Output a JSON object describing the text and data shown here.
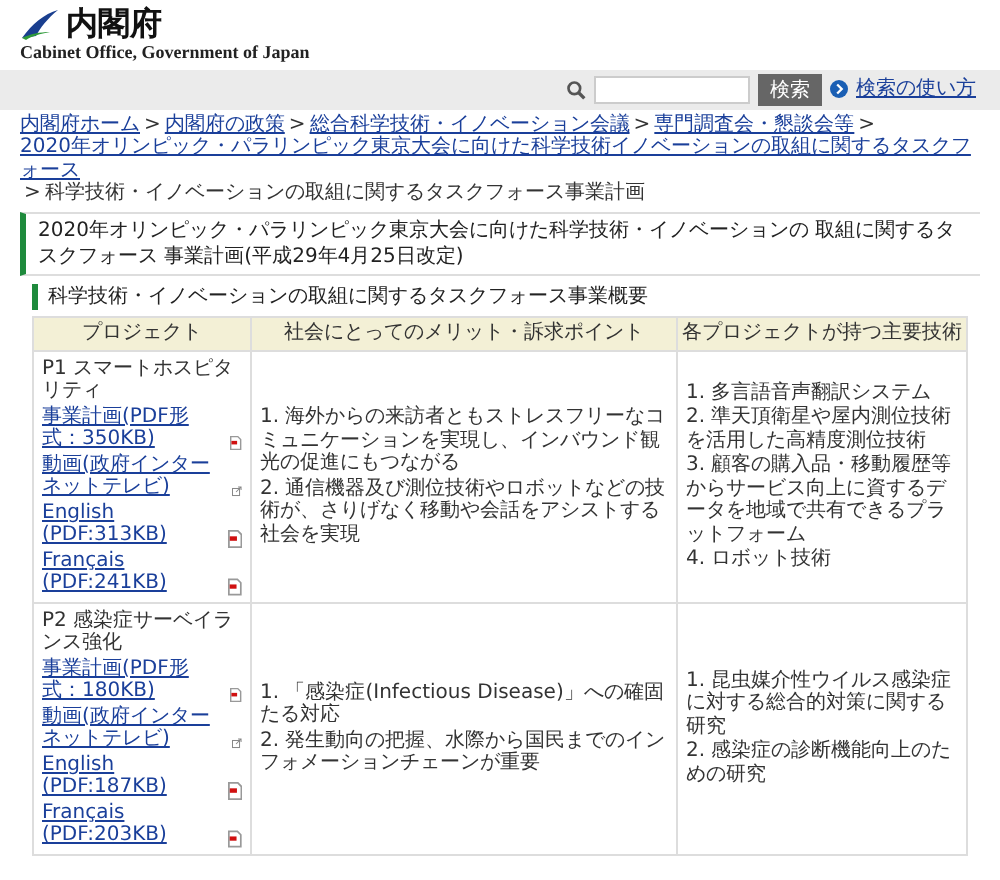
{
  "header": {
    "logo_text": "内閣府",
    "logo_subtitle": "Cabinet Office, Government of Japan"
  },
  "search": {
    "button": "検索",
    "help_link": "検索の使い方"
  },
  "breadcrumb": {
    "links": [
      "内閣府ホーム",
      "内閣府の政策",
      "総合科学技術・イノベーション会議",
      "専門調査会・懇談会等",
      "2020年オリンピック・パラリンピック東京大会に向けた科学技術イノベーションの取組に関するタスクフォース"
    ],
    "separator": ">",
    "current": "科学技術・イノベーションの取組に関するタスクフォース事業計画"
  },
  "page_title": "2020年オリンピック・パラリンピック東京大会に向けた科学技術・イノベーションの 取組に関するタスクフォース 事業計画(平成29年4月25日改定)",
  "section_title": "科学技術・イノベーションの取組に関するタスクフォース事業概要",
  "table": {
    "columns": [
      "プロジェクト",
      "社会にとってのメリット・訴求ポイント",
      "各プロジェクトが持つ主要技術"
    ],
    "rows": [
      {
        "project": "P1 スマートホスピタリティ",
        "links": [
          {
            "kind": "pdf",
            "text": "事業計画(PDF形式：350KB)"
          },
          {
            "kind": "external",
            "text": "動画(政府インターネットテレビ)"
          },
          {
            "kind": "pdf",
            "text": "English (PDF:313KB)"
          },
          {
            "kind": "pdf",
            "text": "Français (PDF:241KB)"
          }
        ],
        "merits": [
          "1. 海外からの来訪者ともストレスフリーなコミュニケーションを実現し、インバウンド観光の促進にもつながる",
          "2. 通信機器及び測位技術やロボットなどの技術が、さりげなく移動や会話をアシストする社会を実現"
        ],
        "technologies": [
          "1. 多言語音声翻訳システム",
          "2. 準天頂衛星や屋内測位技術を活用した高精度測位技術",
          "3. 顧客の購入品・移動履歴等からサービス向上に資するデータを地域で共有できるプラットフォーム",
          "4. ロボット技術"
        ]
      },
      {
        "project": "P2 感染症サーベイランス強化",
        "links": [
          {
            "kind": "pdf",
            "text": "事業計画(PDF形式：180KB)"
          },
          {
            "kind": "external",
            "text": "動画(政府インターネットテレビ)"
          },
          {
            "kind": "pdf",
            "text": "English (PDF:187KB)"
          },
          {
            "kind": "pdf",
            "text": "Français (PDF:203KB)"
          }
        ],
        "merits": [
          "1. 「感染症(Infectious Disease)」への確固たる対応",
          "2. 発生動向の把握、水際から国民までのインフォメーションチェーンが重要"
        ],
        "technologies": [
          "1. 昆虫媒介性ウイルス感染症に対する総合的対策に関する研究",
          "2. 感染症の診断機能向上のための研究"
        ]
      }
    ]
  }
}
